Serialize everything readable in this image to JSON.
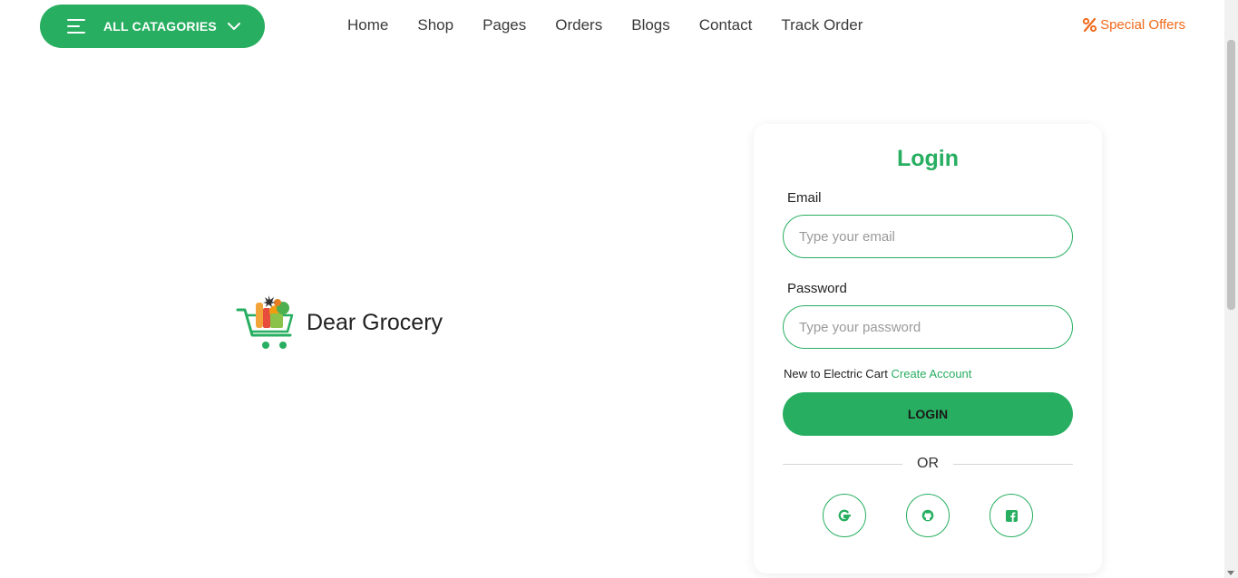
{
  "header": {
    "categories_label": "ALL CATAGORIES",
    "nav": [
      "Home",
      "Shop",
      "Pages",
      "Orders",
      "Blogs",
      "Contact",
      "Track Order"
    ],
    "special_offers": "Special Offers",
    "special_offers_icon": "percent-icon"
  },
  "brand": {
    "name": "Dear Grocery",
    "logo_icon": "grocery-cart-logo"
  },
  "login": {
    "title": "Login",
    "email_label": "Email",
    "email_placeholder": "Type your email",
    "email_value": "",
    "password_label": "Password",
    "password_placeholder": "Type your password",
    "password_value": "",
    "new_text": "New to Electric Cart",
    "create_account": "Create Account",
    "submit": "LOGIN",
    "or": "OR",
    "social": [
      "google-icon",
      "github-icon",
      "facebook-icon"
    ]
  },
  "colors": {
    "accent": "#27ae60",
    "offer": "#f06a1b"
  }
}
